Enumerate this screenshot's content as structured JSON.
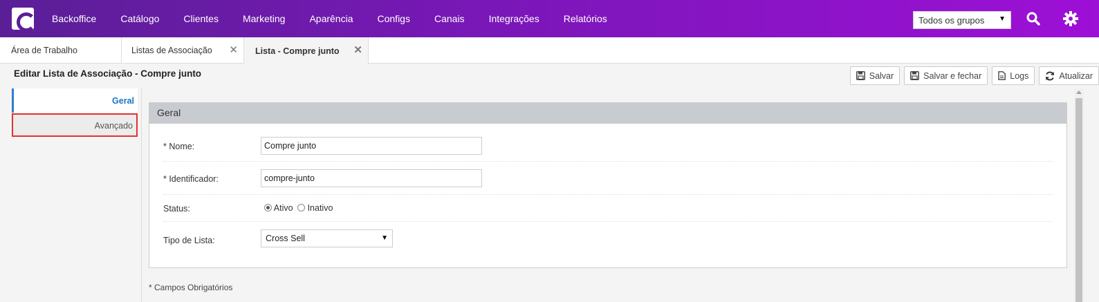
{
  "nav": {
    "items": [
      "Backoffice",
      "Catálogo",
      "Clientes",
      "Marketing",
      "Aparência",
      "Configs",
      "Canais",
      "Integrações",
      "Relatórios"
    ],
    "group_select": "Todos os grupos"
  },
  "tabs": [
    {
      "label": "Área de Trabalho"
    },
    {
      "label": "Listas de Associação"
    },
    {
      "label": "Lista - Compre junto"
    }
  ],
  "page": {
    "title": "Editar Lista de Associação - Compre junto"
  },
  "toolbar": {
    "save": "Salvar",
    "save_close": "Salvar e fechar",
    "logs": "Logs",
    "refresh": "Atualizar"
  },
  "sidebar": {
    "items": [
      {
        "label": "Geral"
      },
      {
        "label": "Avançado"
      }
    ]
  },
  "form": {
    "section_title": "Geral",
    "name_label": "* Nome:",
    "name_value": "Compre junto",
    "identifier_label": "* Identificador:",
    "identifier_value": "compre-junto",
    "status_label": "Status:",
    "status_active": "Ativo",
    "status_inactive": "Inativo",
    "list_type_label": "Tipo de Lista:",
    "list_type_value": "Cross Sell",
    "footnote": "* Campos Obrigatórios"
  },
  "colors": {
    "nav_start": "#5a1f97",
    "nav_end": "#9d10d6",
    "active_link": "#1a73c8",
    "highlight_border": "#e53030"
  }
}
